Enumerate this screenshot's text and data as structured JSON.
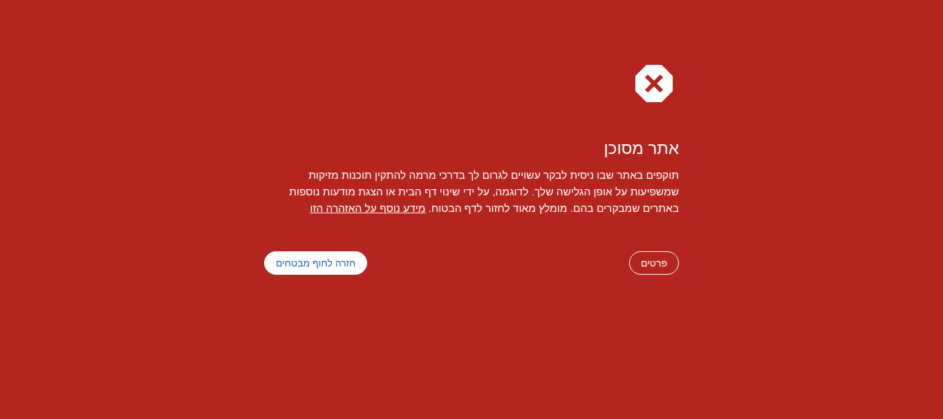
{
  "title": "אתר מסוכן",
  "message": {
    "text": "תוקפים באתר שבו ניסית לבקר עשויים לגרום לך בדרכי מרמה להתקין תוכנות מזיקות שמשפיעות על אופן הגלישה שלך. לדוגמה, על ידי שינוי דף הבית או הצגת מודעות נוספות באתרים שמבקרים בהם. מומלץ מאוד לחזור לדף הבטוח.",
    "link": "מידע נוסף על האזהרה הזו"
  },
  "buttons": [
    {
      "label": "פרטים",
      "kind": "outline"
    },
    {
      "label": "חזרה לחוף מבטחים",
      "kind": "primary"
    }
  ]
}
